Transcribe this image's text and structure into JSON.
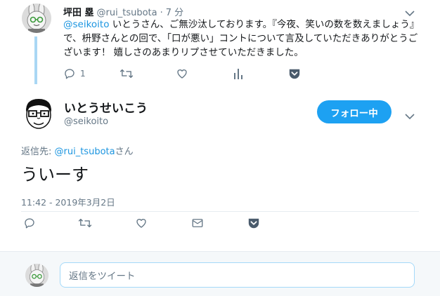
{
  "parent_tweet": {
    "name": "坪田 塁",
    "handle": "@rui_tsubota",
    "dot": "·",
    "time": "7 分",
    "mention": "@seikoito",
    "text": " いとうさん、ご無沙汰しております。『今夜、笑いの数を数えましょう』で、枡野さんとの回で、「口が悪い」コントについて言及していただきありがとうございます！ 嬉しさのあまりリプさせていただきました。",
    "reply_count": "1",
    "icons": [
      "reply-icon",
      "retweet-icon",
      "like-icon",
      "analytics-icon",
      "pocket-icon"
    ]
  },
  "main_tweet": {
    "name": "いとうせいこう",
    "handle": "@seikoito",
    "follow_label": "フォロー中",
    "reply_to_prefix": "返信先: ",
    "reply_to_handle": "@rui_tsubota",
    "reply_to_suffix": "さん",
    "text": "ういーす",
    "timestamp": "11:42 - 2019年3月2日",
    "icons": [
      "reply-icon",
      "retweet-icon",
      "like-icon",
      "message-icon",
      "pocket-icon"
    ]
  },
  "reply_box": {
    "placeholder": "返信をツイート"
  },
  "colors": {
    "accent": "#1da1f2",
    "link": "#1b95e0",
    "secondary_text": "#657786",
    "thread_line": "#a9d7f4",
    "pocket": "#657786"
  }
}
